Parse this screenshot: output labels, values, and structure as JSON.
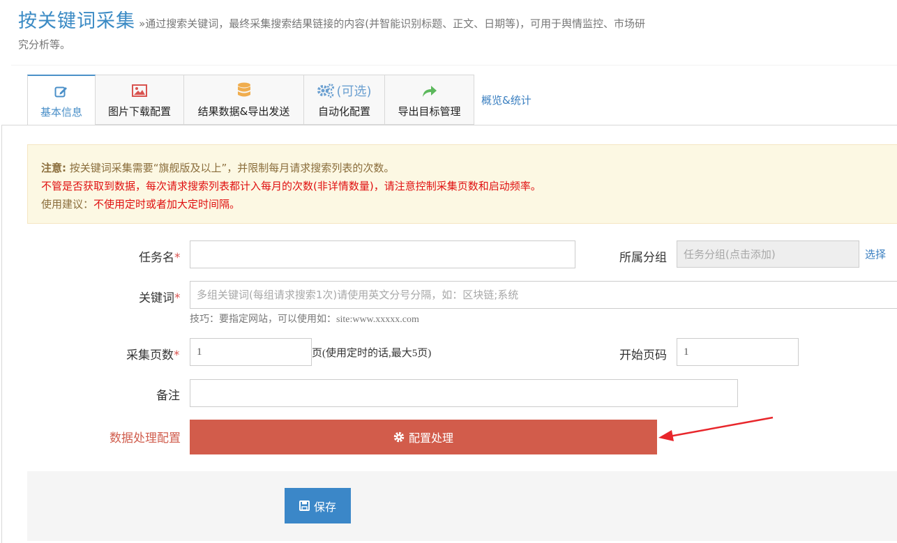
{
  "header": {
    "title": "按关键词采集",
    "description": "»通过搜索关键词，最终采集搜索结果链接的内容(并智能识别标题、正文、日期等)，可用于舆情监控、市场研究分析等。"
  },
  "tabs": [
    {
      "label": "基本信息",
      "icon": "edit-icon",
      "active": true
    },
    {
      "label": "图片下载配置",
      "icon": "image-icon",
      "active": false
    },
    {
      "label": "结果数据&导出发送",
      "icon": "database-icon",
      "active": false
    },
    {
      "label": "自动化配置",
      "icon": "gears-icon",
      "icon_text": "(可选)",
      "active": false
    },
    {
      "label": "导出目标管理",
      "icon": "share-arrow-icon",
      "active": false
    }
  ],
  "stats_link": "概览&统计",
  "notice": {
    "line1_strong": "注意:",
    "line1_text": " 按关键词采集需要“旗舰版及以上”，并限制每月请求搜索列表的次数。",
    "line2": "不管是否获取到数据，每次请求搜索列表都计入每月的次数(非详情数量)，请注意控制采集页数和启动频率。",
    "line3_prefix": "使用建议：",
    "line3_red": "不使用定时或者加大定时间隔。"
  },
  "form": {
    "required_mark": "*",
    "task_name_label": "任务名",
    "task_name_value": "",
    "group_label": "所属分组",
    "group_placeholder": "任务分组(点击添加)",
    "group_select_link": "选择",
    "keyword_label": "关键词",
    "keyword_placeholder": "多组关键词(每组请求搜索1次)请使用英文分号分隔，如：区块链;系统",
    "keyword_hint": "技巧：要指定网站，可以使用如：site:www.xxxxx.com",
    "pages_label": "采集页数",
    "pages_value": "1",
    "pages_suffix": "页(使用定时的话,最大5页)",
    "start_page_label": "开始页码",
    "start_page_value": "1",
    "remark_label": "备注",
    "remark_value": "",
    "data_process_label": "数据处理配置",
    "config_button_label": "配置处理"
  },
  "save_button_label": "保存",
  "colors": {
    "accent_blue": "#3b87c8",
    "config_red": "#d25c4b",
    "warning_red": "#e01010",
    "notice_bg": "#fcf8e3",
    "arrow_red": "#e8262b"
  }
}
